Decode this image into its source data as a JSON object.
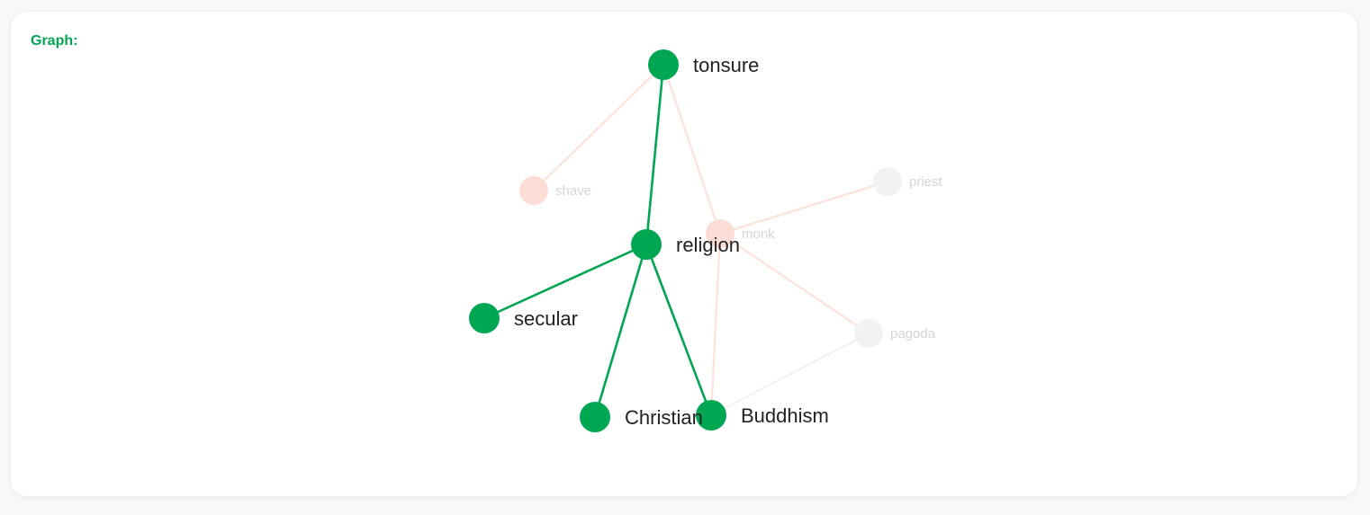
{
  "card": {
    "title": "Graph:"
  },
  "colors": {
    "accent": "#00a651",
    "highlight_node": "#00a651",
    "highlight_edge": "#00a651",
    "highlight_label": "#222222",
    "faded_pink_node": "#fcddd5",
    "faded_pink_edge": "#fde3db",
    "faded_grey_node": "#f2f2f2",
    "faded_grey_edge": "#f3efee",
    "faded_label": "#d5d5d5"
  },
  "graph": {
    "nodes": [
      {
        "id": "tonsure",
        "label": "tonsure",
        "state": "highlight"
      },
      {
        "id": "religion",
        "label": "religion",
        "state": "highlight"
      },
      {
        "id": "secular",
        "label": "secular",
        "state": "highlight"
      },
      {
        "id": "Christian",
        "label": "Christian",
        "state": "highlight"
      },
      {
        "id": "Buddhism",
        "label": "Buddhism",
        "state": "highlight"
      },
      {
        "id": "shave",
        "label": "shave",
        "state": "faded-pink"
      },
      {
        "id": "monk",
        "label": "monk",
        "state": "faded-pink"
      },
      {
        "id": "priest",
        "label": "priest",
        "state": "faded-grey"
      },
      {
        "id": "pagoda",
        "label": "pagoda",
        "state": "faded-grey"
      }
    ],
    "edges": [
      {
        "source": "tonsure",
        "target": "shave",
        "state": "faded-pink"
      },
      {
        "source": "tonsure",
        "target": "monk",
        "state": "faded-pink"
      },
      {
        "source": "monk",
        "target": "priest",
        "state": "faded-pink"
      },
      {
        "source": "monk",
        "target": "pagoda",
        "state": "faded-pink"
      },
      {
        "source": "monk",
        "target": "Buddhism",
        "state": "faded-pink"
      },
      {
        "source": "pagoda",
        "target": "Buddhism",
        "state": "faded-grey"
      },
      {
        "source": "tonsure",
        "target": "religion",
        "state": "highlight"
      },
      {
        "source": "religion",
        "target": "secular",
        "state": "highlight"
      },
      {
        "source": "religion",
        "target": "Christian",
        "state": "highlight"
      },
      {
        "source": "religion",
        "target": "Buddhism",
        "state": "highlight"
      }
    ]
  }
}
